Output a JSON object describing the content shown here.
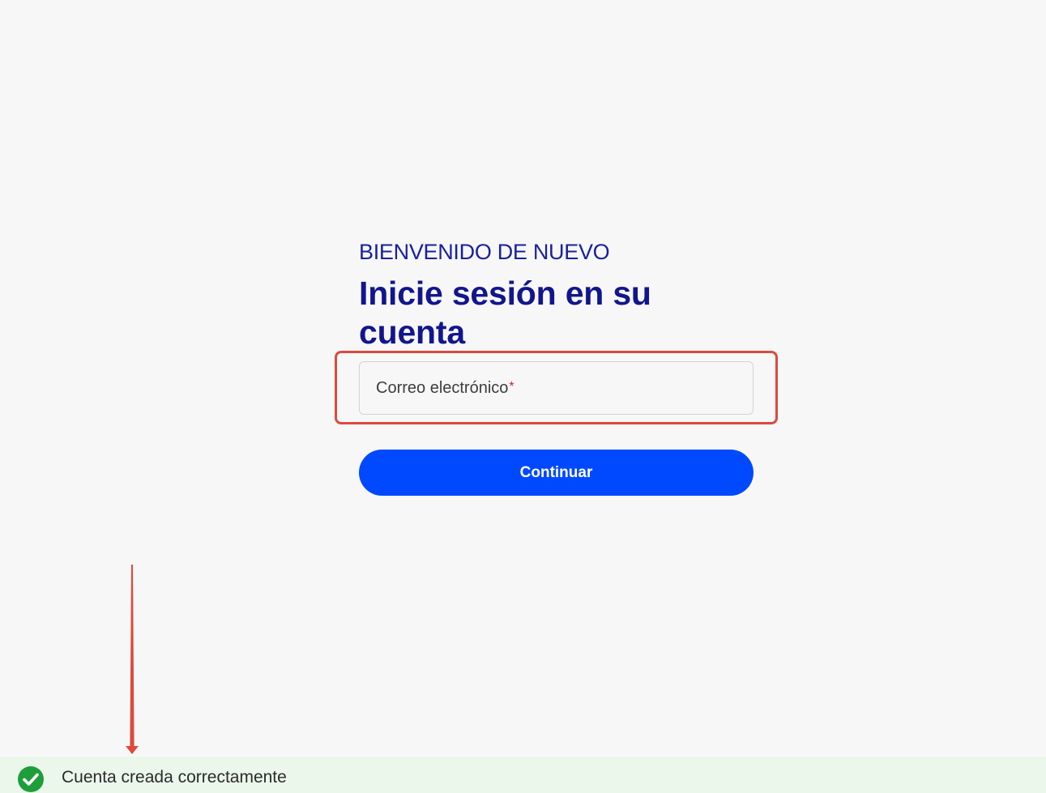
{
  "header": {
    "eyebrow": "BIENVENIDO DE NUEVO",
    "title": "Inicie sesión en su cuenta"
  },
  "form": {
    "email_placeholder": "Correo electrónico",
    "required_mark": "*",
    "continue_label": "Continuar"
  },
  "toast": {
    "message": "Cuenta creada correctamente",
    "icon": "check-circle-icon"
  },
  "colors": {
    "brand_navy": "#12168c",
    "primary_button": "#0049ff",
    "annotation_red": "#dc4a3d",
    "success_green": "#1e9e3a",
    "toast_background": "#eaf7ea"
  }
}
